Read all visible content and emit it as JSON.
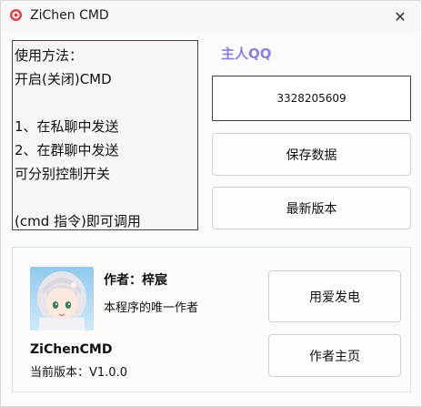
{
  "window": {
    "title": "ZiChen CMD",
    "close_symbol": "✕"
  },
  "instructions": {
    "lines": [
      "使用方法：",
      "开启(关闭)CMD",
      "",
      "1、在私聊中发送",
      "2、在群聊中发送",
      "可分别控制开关",
      "",
      "(cmd 指令)即可调用"
    ]
  },
  "owner": {
    "label": "主人QQ",
    "qq_number": "3328205609"
  },
  "buttons": {
    "save_label": "保存数据",
    "latest_label": "最新版本",
    "power_label": "用爱发电",
    "homepage_label": "作者主页"
  },
  "author": {
    "title": "作者：梓宸",
    "description": "本程序的唯一作者",
    "app_name": "ZiChenCMD",
    "version_text": "当前版本：V1.0.0"
  },
  "colors": {
    "accent": "#8a82d8",
    "icon_red": "#e0454f"
  }
}
